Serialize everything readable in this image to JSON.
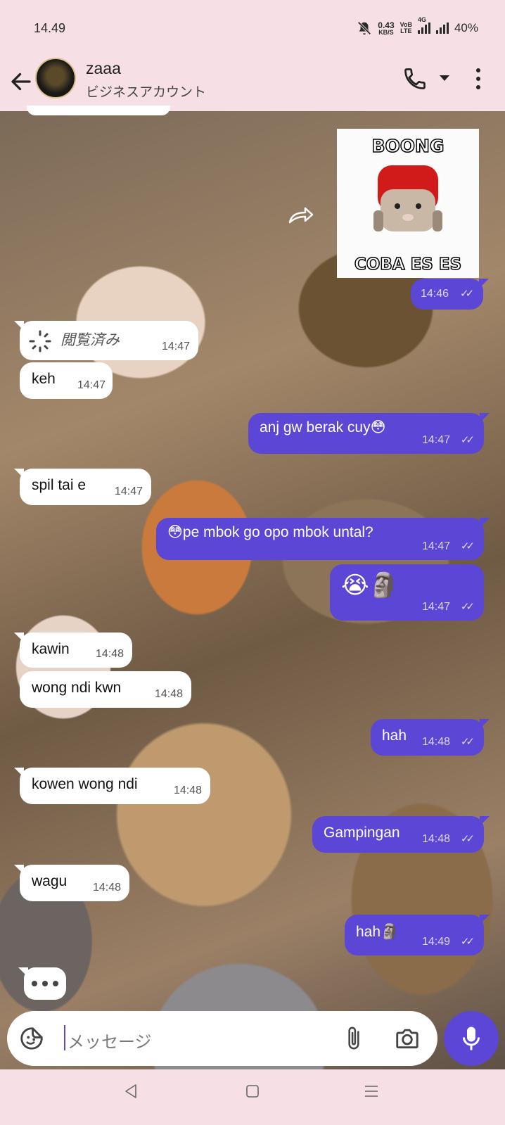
{
  "status_bar": {
    "time": "14.49",
    "net_speed_value": "0.43",
    "net_speed_unit": "KB/S",
    "volte_top": "VoB",
    "volte_bottom": "LTE",
    "network_4g": "4G",
    "battery": "40%"
  },
  "header": {
    "contact_name": "zaaa",
    "contact_subtitle": "ビジネスアカウント"
  },
  "sticker": {
    "top_text": "BOONG",
    "bottom_text": "COBA ES ES"
  },
  "messages": [
    {
      "dir": "out",
      "text": "",
      "time": "14:46"
    },
    {
      "dir": "in",
      "text": "閲覧済み",
      "time": "14:47"
    },
    {
      "dir": "in",
      "text": "keh",
      "time": "14:47"
    },
    {
      "dir": "out",
      "text": "anj gw berak cuy😳",
      "time": "14:47"
    },
    {
      "dir": "in",
      "text": "spil tai e",
      "time": "14:47"
    },
    {
      "dir": "out",
      "text": "😳pe mbok go opo mbok untal?",
      "time": "14:47"
    },
    {
      "dir": "out",
      "text": "😭🗿",
      "time": "14:47"
    },
    {
      "dir": "in",
      "text": "kawin",
      "time": "14:48"
    },
    {
      "dir": "in",
      "text": "wong ndi kwn",
      "time": "14:48"
    },
    {
      "dir": "out",
      "text": "hah",
      "time": "14:48"
    },
    {
      "dir": "in",
      "text": "kowen wong ndi",
      "time": "14:48"
    },
    {
      "dir": "out",
      "text": "Gampingan",
      "time": "14:48"
    },
    {
      "dir": "in",
      "text": "wagu",
      "time": "14:48"
    },
    {
      "dir": "out",
      "text": "hah🗿",
      "time": "14:49"
    }
  ],
  "composer": {
    "placeholder": "メッセージ"
  },
  "colors": {
    "accent": "#5b46d6",
    "bar_background": "#f6e0e6",
    "incoming_bubble": "#ffffff"
  }
}
